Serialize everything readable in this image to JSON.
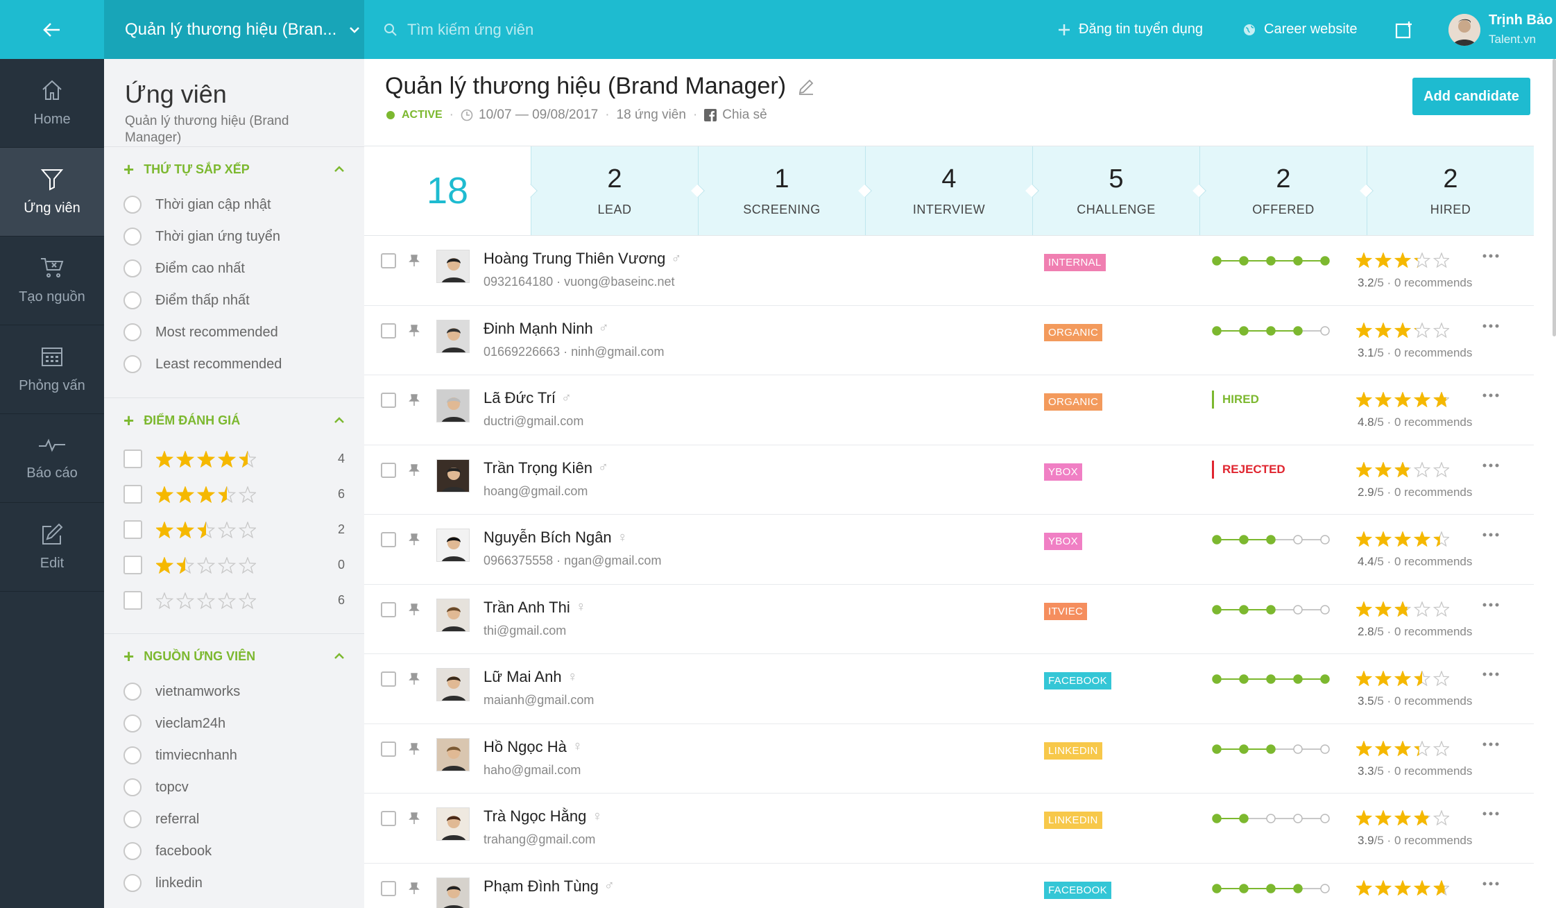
{
  "header": {
    "job_select": "Quản lý thương hiệu (Bran...",
    "search_placeholder": "Tìm kiếm ứng viên",
    "post_job": "Đăng tin tuyển dụng",
    "career_site": "Career website",
    "user_name": "Trịnh Bảo",
    "user_company": "Talent.vn"
  },
  "nav": [
    {
      "label": "Home",
      "icon": "home-icon"
    },
    {
      "label": "Ứng viên",
      "icon": "funnel-icon"
    },
    {
      "label": "Tạo nguồn",
      "icon": "cart-icon"
    },
    {
      "label": "Phỏng vấn",
      "icon": "calendar-icon"
    },
    {
      "label": "Báo cáo",
      "icon": "pulse-icon"
    },
    {
      "label": "Edit",
      "icon": "edit-icon"
    }
  ],
  "filter": {
    "title": "Ứng viên",
    "subtitle": "Quản lý thương hiệu (Brand Manager)",
    "sort": {
      "heading": "THỨ TỰ SẮP XẾP",
      "options": [
        "Thời gian cập nhật",
        "Thời gian ứng tuyển",
        "Điểm cao nhất",
        "Điểm thấp nhất",
        "Most recommended",
        "Least recommended"
      ]
    },
    "rating": {
      "heading": "ĐIỂM ĐÁNH GIÁ",
      "options": [
        {
          "stars": 4.5,
          "count": "4"
        },
        {
          "stars": 3.5,
          "count": "6"
        },
        {
          "stars": 2.5,
          "count": "2"
        },
        {
          "stars": 1.5,
          "count": "0"
        },
        {
          "stars": 0,
          "count": "6"
        }
      ]
    },
    "source": {
      "heading": "NGUỒN ỨNG VIÊN",
      "options": [
        "vietnamworks",
        "vieclam24h",
        "timviecnhanh",
        "topcv",
        "referral",
        "facebook",
        "linkedin"
      ]
    }
  },
  "job": {
    "title": "Quản lý thương hiệu (Brand Manager)",
    "status": "ACTIVE",
    "dates": "10/07 — 09/08/2017",
    "count": "18 ứng viên",
    "share": "Chia sẻ",
    "add_button": "Add candidate"
  },
  "pipeline": {
    "total": "18",
    "stages": [
      {
        "num": "2",
        "label": "LEAD"
      },
      {
        "num": "1",
        "label": "SCREENING"
      },
      {
        "num": "4",
        "label": "INTERVIEW"
      },
      {
        "num": "5",
        "label": "CHALLENGE"
      },
      {
        "num": "2",
        "label": "OFFERED"
      },
      {
        "num": "2",
        "label": "HIRED"
      }
    ]
  },
  "source_colors": {
    "INTERNAL": "#f07fb1",
    "ORGANIC": "#f39a5c",
    "YBOX": "#f07fc4",
    "ITVIEC": "#f58e5e",
    "FACEBOOK": "#34c6d6",
    "LINKEDIN": "#f7c84a"
  },
  "candidates": [
    {
      "name": "Hoàng Trung Thiên Vương",
      "gender": "♂",
      "contact": "0932164180 · vuong@baseinc.net",
      "source": "INTERNAL",
      "progress": 5,
      "rating": 3.2,
      "score": "3.2",
      "recommends": "0 recommends"
    },
    {
      "name": "Đinh Mạnh Ninh",
      "gender": "♂",
      "contact": "01669226663 · ninh@gmail.com",
      "source": "ORGANIC",
      "progress": 4,
      "rating": 3.1,
      "score": "3.1",
      "recommends": "0 recommends"
    },
    {
      "name": "Lã Đức Trí",
      "gender": "♂",
      "contact": "ductri@gmail.com",
      "source": "ORGANIC",
      "status": "HIRED",
      "status_color": "#7cb82f",
      "rating": 4.8,
      "score": "4.8",
      "recommends": "0 recommends"
    },
    {
      "name": "Trần Trọng Kiên",
      "gender": "♂",
      "contact": "hoang@gmail.com",
      "source": "YBOX",
      "status": "REJECTED",
      "status_color": "#e0252f",
      "rating": 2.9,
      "score": "2.9",
      "recommends": "0 recommends"
    },
    {
      "name": "Nguyễn Bích Ngân",
      "gender": "♀",
      "contact": "0966375558 · ngan@gmail.com",
      "source": "YBOX",
      "progress": 3,
      "rating": 4.4,
      "score": "4.4",
      "recommends": "0 recommends"
    },
    {
      "name": "Trần Anh Thi",
      "gender": "♀",
      "contact": "thi@gmail.com",
      "source": "ITVIEC",
      "progress": 3,
      "rating": 2.8,
      "score": "2.8",
      "recommends": "0 recommends"
    },
    {
      "name": "Lữ Mai Anh",
      "gender": "♀",
      "contact": "maianh@gmail.com",
      "source": "FACEBOOK",
      "progress": 5,
      "rating": 3.5,
      "score": "3.5",
      "recommends": "0 recommends"
    },
    {
      "name": "Hồ Ngọc Hà",
      "gender": "♀",
      "contact": "haho@gmail.com",
      "source": "LINKEDIN",
      "progress": 3,
      "rating": 3.3,
      "score": "3.3",
      "recommends": "0 recommends"
    },
    {
      "name": "Trà Ngọc Hằng",
      "gender": "♀",
      "contact": "trahang@gmail.com",
      "source": "LINKEDIN",
      "progress": 2,
      "rating": 3.9,
      "score": "3.9",
      "recommends": "0 recommends"
    },
    {
      "name": "Phạm Đình Tùng",
      "gender": "♂",
      "contact": "",
      "source": "FACEBOOK",
      "progress": 4,
      "rating": 4.7,
      "score": "",
      "recommends": ""
    }
  ]
}
